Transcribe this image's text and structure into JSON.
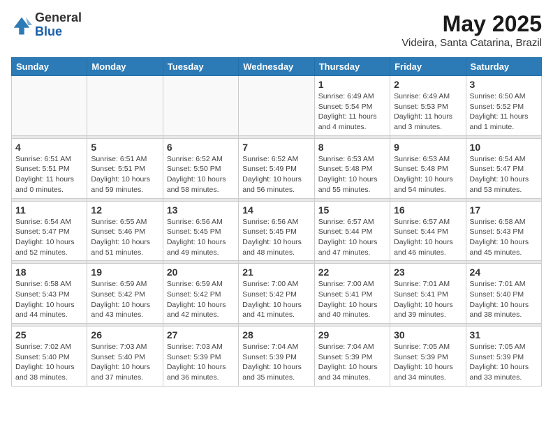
{
  "header": {
    "logo_general": "General",
    "logo_blue": "Blue",
    "main_title": "May 2025",
    "subtitle": "Videira, Santa Catarina, Brazil"
  },
  "days_of_week": [
    "Sunday",
    "Monday",
    "Tuesday",
    "Wednesday",
    "Thursday",
    "Friday",
    "Saturday"
  ],
  "weeks": [
    {
      "days": [
        {
          "number": "",
          "info": ""
        },
        {
          "number": "",
          "info": ""
        },
        {
          "number": "",
          "info": ""
        },
        {
          "number": "",
          "info": ""
        },
        {
          "number": "1",
          "info": "Sunrise: 6:49 AM\nSunset: 5:54 PM\nDaylight: 11 hours\nand 4 minutes."
        },
        {
          "number": "2",
          "info": "Sunrise: 6:49 AM\nSunset: 5:53 PM\nDaylight: 11 hours\nand 3 minutes."
        },
        {
          "number": "3",
          "info": "Sunrise: 6:50 AM\nSunset: 5:52 PM\nDaylight: 11 hours\nand 1 minute."
        }
      ]
    },
    {
      "days": [
        {
          "number": "4",
          "info": "Sunrise: 6:51 AM\nSunset: 5:51 PM\nDaylight: 11 hours\nand 0 minutes."
        },
        {
          "number": "5",
          "info": "Sunrise: 6:51 AM\nSunset: 5:51 PM\nDaylight: 10 hours\nand 59 minutes."
        },
        {
          "number": "6",
          "info": "Sunrise: 6:52 AM\nSunset: 5:50 PM\nDaylight: 10 hours\nand 58 minutes."
        },
        {
          "number": "7",
          "info": "Sunrise: 6:52 AM\nSunset: 5:49 PM\nDaylight: 10 hours\nand 56 minutes."
        },
        {
          "number": "8",
          "info": "Sunrise: 6:53 AM\nSunset: 5:48 PM\nDaylight: 10 hours\nand 55 minutes."
        },
        {
          "number": "9",
          "info": "Sunrise: 6:53 AM\nSunset: 5:48 PM\nDaylight: 10 hours\nand 54 minutes."
        },
        {
          "number": "10",
          "info": "Sunrise: 6:54 AM\nSunset: 5:47 PM\nDaylight: 10 hours\nand 53 minutes."
        }
      ]
    },
    {
      "days": [
        {
          "number": "11",
          "info": "Sunrise: 6:54 AM\nSunset: 5:47 PM\nDaylight: 10 hours\nand 52 minutes."
        },
        {
          "number": "12",
          "info": "Sunrise: 6:55 AM\nSunset: 5:46 PM\nDaylight: 10 hours\nand 51 minutes."
        },
        {
          "number": "13",
          "info": "Sunrise: 6:56 AM\nSunset: 5:45 PM\nDaylight: 10 hours\nand 49 minutes."
        },
        {
          "number": "14",
          "info": "Sunrise: 6:56 AM\nSunset: 5:45 PM\nDaylight: 10 hours\nand 48 minutes."
        },
        {
          "number": "15",
          "info": "Sunrise: 6:57 AM\nSunset: 5:44 PM\nDaylight: 10 hours\nand 47 minutes."
        },
        {
          "number": "16",
          "info": "Sunrise: 6:57 AM\nSunset: 5:44 PM\nDaylight: 10 hours\nand 46 minutes."
        },
        {
          "number": "17",
          "info": "Sunrise: 6:58 AM\nSunset: 5:43 PM\nDaylight: 10 hours\nand 45 minutes."
        }
      ]
    },
    {
      "days": [
        {
          "number": "18",
          "info": "Sunrise: 6:58 AM\nSunset: 5:43 PM\nDaylight: 10 hours\nand 44 minutes."
        },
        {
          "number": "19",
          "info": "Sunrise: 6:59 AM\nSunset: 5:42 PM\nDaylight: 10 hours\nand 43 minutes."
        },
        {
          "number": "20",
          "info": "Sunrise: 6:59 AM\nSunset: 5:42 PM\nDaylight: 10 hours\nand 42 minutes."
        },
        {
          "number": "21",
          "info": "Sunrise: 7:00 AM\nSunset: 5:42 PM\nDaylight: 10 hours\nand 41 minutes."
        },
        {
          "number": "22",
          "info": "Sunrise: 7:00 AM\nSunset: 5:41 PM\nDaylight: 10 hours\nand 40 minutes."
        },
        {
          "number": "23",
          "info": "Sunrise: 7:01 AM\nSunset: 5:41 PM\nDaylight: 10 hours\nand 39 minutes."
        },
        {
          "number": "24",
          "info": "Sunrise: 7:01 AM\nSunset: 5:40 PM\nDaylight: 10 hours\nand 38 minutes."
        }
      ]
    },
    {
      "days": [
        {
          "number": "25",
          "info": "Sunrise: 7:02 AM\nSunset: 5:40 PM\nDaylight: 10 hours\nand 38 minutes."
        },
        {
          "number": "26",
          "info": "Sunrise: 7:03 AM\nSunset: 5:40 PM\nDaylight: 10 hours\nand 37 minutes."
        },
        {
          "number": "27",
          "info": "Sunrise: 7:03 AM\nSunset: 5:39 PM\nDaylight: 10 hours\nand 36 minutes."
        },
        {
          "number": "28",
          "info": "Sunrise: 7:04 AM\nSunset: 5:39 PM\nDaylight: 10 hours\nand 35 minutes."
        },
        {
          "number": "29",
          "info": "Sunrise: 7:04 AM\nSunset: 5:39 PM\nDaylight: 10 hours\nand 34 minutes."
        },
        {
          "number": "30",
          "info": "Sunrise: 7:05 AM\nSunset: 5:39 PM\nDaylight: 10 hours\nand 34 minutes."
        },
        {
          "number": "31",
          "info": "Sunrise: 7:05 AM\nSunset: 5:39 PM\nDaylight: 10 hours\nand 33 minutes."
        }
      ]
    }
  ]
}
